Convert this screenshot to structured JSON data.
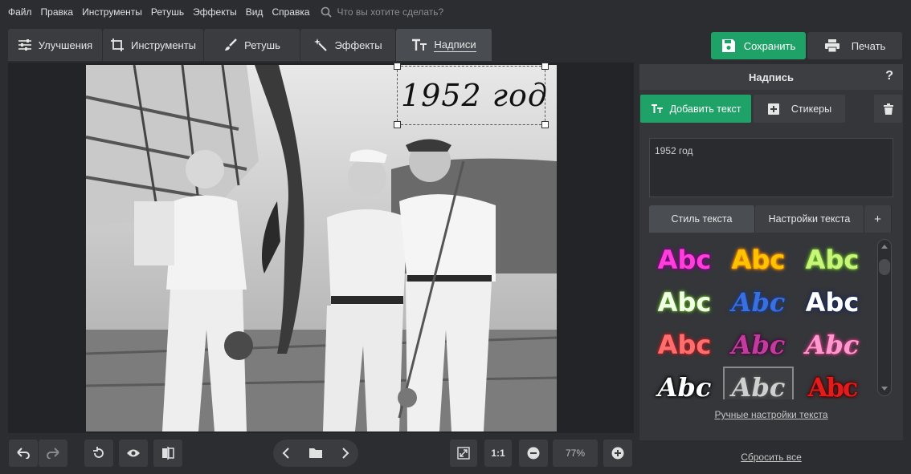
{
  "menu": {
    "items": [
      "Файл",
      "Правка",
      "Инструменты",
      "Ретушь",
      "Эффекты",
      "Вид",
      "Справка"
    ],
    "search_placeholder": "Что вы хотите сделать?"
  },
  "tabs": [
    {
      "label": "Улучшения",
      "icon": "sliders-icon"
    },
    {
      "label": "Инструменты",
      "icon": "crop-icon"
    },
    {
      "label": "Ретушь",
      "icon": "brush-icon"
    },
    {
      "label": "Эффекты",
      "icon": "magic-wand-icon"
    },
    {
      "label": "Надписи",
      "icon": "text-icon",
      "active": true
    }
  ],
  "toolbar": {
    "save_label": "Сохранить",
    "print_label": "Печать"
  },
  "canvas": {
    "overlay_text": "1952 год"
  },
  "bottom": {
    "zoom_fit_label": "1:1",
    "zoom_value": "77%"
  },
  "panel": {
    "title": "Надпись",
    "help": "?",
    "add_text_label": "Добавить текст",
    "stickers_label": "Стикеры",
    "text_value": "1952 год",
    "subtabs": [
      "Стиль текста",
      "Настройки текста",
      "+"
    ],
    "style_sample": "Abc",
    "styles": [
      {
        "color": "#ff3fd8",
        "glow": "#8a0090",
        "font": "sans"
      },
      {
        "color": "#ffc400",
        "glow": "#ff8a00",
        "font": "sans"
      },
      {
        "color": "#c9f57a",
        "glow": "#6ab82c",
        "font": "sans"
      },
      {
        "color": "#f0ffe6",
        "glow": "#5da02a",
        "font": "sans"
      },
      {
        "color": "#3a6fe0",
        "glow": "#1b3d8a",
        "font": "script"
      },
      {
        "color": "#ffffff",
        "glow": "#1c2a5a",
        "font": "sans"
      },
      {
        "color": "#ff6f6f",
        "glow": "#b02020",
        "font": "sans"
      },
      {
        "color": "#c23ca0",
        "glow": "#4a0a3a",
        "font": "script"
      },
      {
        "color": "#ff9ad0",
        "glow": "#c23a7a",
        "font": "script"
      },
      {
        "color": "#ffffff",
        "glow": "#000000",
        "font": "script"
      },
      {
        "color": "#cfcfcf",
        "glow": "#555555",
        "font": "script"
      },
      {
        "color": "#e01c1c",
        "glow": "#550000",
        "font": "gothic"
      }
    ],
    "manual_settings_link": "Ручные настройки текста",
    "reset_link": "Сбросить все"
  },
  "colors": {
    "accent_green": "#1fa267",
    "background": "#2b2d30"
  }
}
